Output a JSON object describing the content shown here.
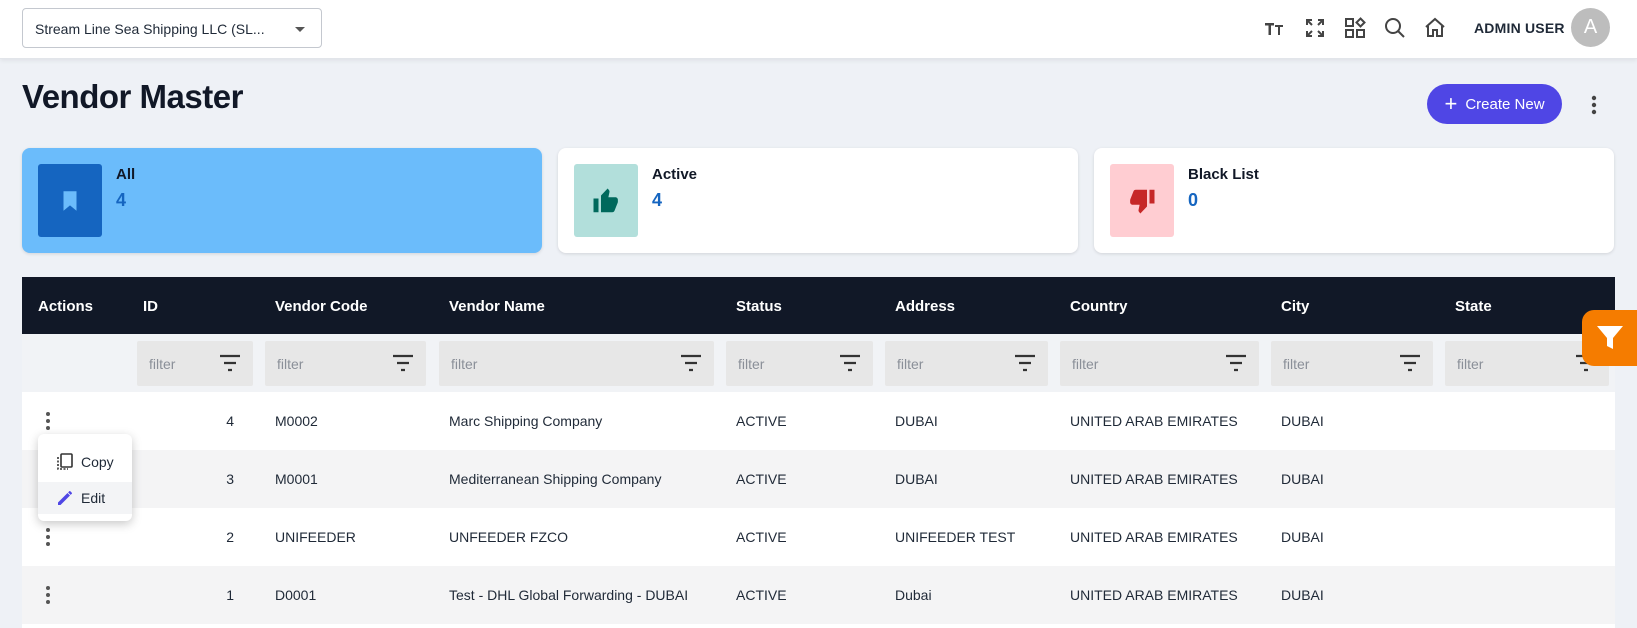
{
  "header": {
    "company_select_value": "Stream Line Sea Shipping LLC  (SL...",
    "icons": [
      "text-size-icon",
      "fullscreen-icon",
      "apps-icon",
      "search-icon",
      "home-icon"
    ],
    "user_name": "ADMIN USER",
    "avatar_initial": "A"
  },
  "page": {
    "title": "Vendor Master",
    "create_label": "Create New"
  },
  "cards": [
    {
      "label": "All",
      "count": "4",
      "icon": "bookmark-icon",
      "bg": "#6bbcfb",
      "icon_bg": "#1565c0"
    },
    {
      "label": "Active",
      "count": "4",
      "icon": "thumbs-up-icon",
      "bg": "#ffffff",
      "icon_bg": "#b2dfdb"
    },
    {
      "label": "Black List",
      "count": "0",
      "icon": "thumbs-down-icon",
      "bg": "#ffffff",
      "icon_bg": "#ffcdd2"
    }
  ],
  "table": {
    "columns": [
      "Actions",
      "ID",
      "Vendor Code",
      "Vendor Name",
      "Status",
      "Address",
      "Country",
      "City",
      "State"
    ],
    "filter_placeholder": "filter",
    "rows": [
      {
        "id": "4",
        "code": "M0002",
        "name": "Marc Shipping Company",
        "status": "ACTIVE",
        "address": "DUBAI",
        "country": "UNITED ARAB EMIRATES",
        "city": "DUBAI",
        "state": ""
      },
      {
        "id": "3",
        "code": "M0001",
        "name": "Mediterranean Shipping Company",
        "status": "ACTIVE",
        "address": "DUBAI",
        "country": "UNITED ARAB EMIRATES",
        "city": "DUBAI",
        "state": ""
      },
      {
        "id": "2",
        "code": "UNIFEEDER",
        "name": "UNFEEDER FZCO",
        "status": "ACTIVE",
        "address": "UNIFEEDER TEST",
        "country": "UNITED ARAB EMIRATES",
        "city": "DUBAI",
        "state": ""
      },
      {
        "id": "1",
        "code": "D0001",
        "name": "Test - DHL Global Forwarding - DUBAI",
        "status": "ACTIVE",
        "address": "Dubai",
        "country": "UNITED ARAB EMIRATES",
        "city": "DUBAI",
        "state": ""
      }
    ]
  },
  "row_menu": {
    "copy_label": "Copy",
    "edit_label": "Edit"
  },
  "colors": {
    "accent": "#4f46e5",
    "table_header": "#111827",
    "fab": "#f57c00"
  }
}
